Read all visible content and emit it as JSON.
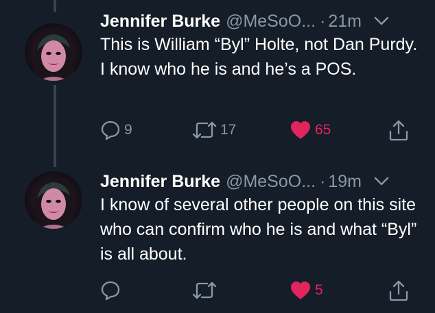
{
  "tweets": [
    {
      "author_name": "Jennifer Burke",
      "handle": "@MeSoO...",
      "separator": "·",
      "time": "21m",
      "text": "This is William “Byl” Holte, not Dan Purdy. I know who he is and he’s a POS.",
      "reply_count": "9",
      "retweet_count": "17",
      "like_count": "65",
      "liked": true
    },
    {
      "author_name": "Jennifer Burke",
      "handle": "@MeSoO...",
      "separator": "·",
      "time": "19m",
      "text": "I know of several other people on this site who can confirm who he is and what “Byl” is all about.",
      "reply_count": "",
      "retweet_count": "",
      "like_count": "5",
      "liked": true
    }
  ],
  "icons": {
    "reply": "reply-icon",
    "retweet": "retweet-icon",
    "like": "heart-icon",
    "share": "share-icon",
    "menu": "chevron-down-icon"
  },
  "colors": {
    "background": "#151d28",
    "primary_text": "#ffffff",
    "secondary_text": "#8899a6",
    "like": "#e0245e",
    "thread_line": "#38444d"
  }
}
